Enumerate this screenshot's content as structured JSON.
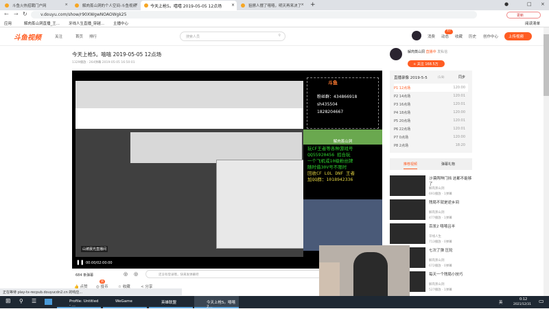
{
  "tabs": [
    {
      "label": "斗鱼火热招聘门户网"
    },
    {
      "label": "解肉蒸山洞的个人空间-斗鱼视频"
    },
    {
      "label": "今天上枪5。嘻嘻 2019-05-05 12点场"
    },
    {
      "label": "狙擦人摆了嘻嘻，明天再来决了"
    }
  ],
  "address": {
    "url": "v.douyu.com/show/r90XWgwNOAOWgk25",
    "update_label": "更新"
  },
  "bookmarks": [
    "应用",
    "解肉蒸山洞直播_王...",
    "牙线人生直播_穿越...",
    "主播中心"
  ],
  "bookmarks_right": "阅读清单",
  "header": {
    "logo": "斗鱼视频",
    "follow": "关注",
    "nav": [
      "首页",
      "排行"
    ],
    "search_placeholder": "搜索人员",
    "links": [
      "消费",
      "动态",
      "收藏",
      "历史",
      "创作中心"
    ],
    "badge": "47",
    "upload": "上传视频"
  },
  "video": {
    "title": "今天上枪5。嘻嘻 2019-05-05 12点场",
    "meta": "1329播放 · 264弹幕  2019-05-05 16:50:01",
    "time": "00:00/02:00:00",
    "inner_label": "山坡晨光直播间",
    "danmaku_count": "684 条弹幕",
    "danmaku_placeholder": "还没有登录哦，快来发弹幕吧"
  },
  "overlay": {
    "qq_group_label": "粉丝群：434866918",
    "wechat": "sh435504",
    "qq": "1828204667",
    "brand": "斗鱼",
    "name": "解肉蒸山洞",
    "lines": [
      "玩CF王者等各种游戏号",
      "QQ55920456 招合玩",
      "一个飞机或10级粉丝牌",
      "随时借30V号不限时",
      "回收CF LOL DNF 王者",
      "加QQ群：1018942336"
    ]
  },
  "actions": [
    {
      "label": "点赞"
    },
    {
      "label": "投币",
      "badge": "热"
    },
    {
      "label": "收藏"
    },
    {
      "label": "分享"
    }
  ],
  "streamer": {
    "name": "解肉蒸山洞",
    "tag": "直播中",
    "other": "发私信",
    "follow": "+ 关注 168.5万"
  },
  "episodes": {
    "title": "直播录像 2019-5-5",
    "count": "(1/8)",
    "sort": "同步",
    "items": [
      {
        "name": "P1 12点场",
        "time": "120:00"
      },
      {
        "name": "P2 14点场",
        "time": "120:01"
      },
      {
        "name": "P3 16点场",
        "time": "120:01"
      },
      {
        "name": "P4 18点场",
        "time": "120:00"
      },
      {
        "name": "P5 20点场",
        "time": "120:01"
      },
      {
        "name": "P6 22点场",
        "time": "120:01"
      },
      {
        "name": "P7 0点场",
        "time": "120:00"
      },
      {
        "name": "P8 2点场",
        "time": "18:20"
      }
    ]
  },
  "rec_tabs": [
    "推荐视频",
    "弹幕礼物"
  ],
  "recommended": [
    {
      "title": "沙漠两种门挡 这都不能够了",
      "author": "解肉蒸山洞",
      "stats": "691播放 · 1弹幕"
    },
    {
      "title": "残局不就是逆乡间",
      "author": "解肉蒸山洞",
      "stats": "477播放 · 1弹幕"
    },
    {
      "title": "百发2 嘻嘻吕半",
      "author": "牙线人生",
      "stats": "713播放 · 0弹幕"
    },
    {
      "title": "七次了弹 压轮",
      "author": "解肉蒸山洞",
      "stats": "672播放 · 0弹幕"
    },
    {
      "title": "每天一个残局小技巧",
      "author": "解肉蒸山洞",
      "stats": "527播放 · 1弹幕"
    }
  ],
  "status_bar": "正在等待 play-tx-recpub.douyucdn2.cn 的响应...",
  "taskbar": {
    "apps": [
      "Profile: Untitled - ...",
      "WeGame",
      "英雄联盟",
      "今天上枪5。嘻嘻 2..."
    ],
    "time": "0:12",
    "date": "2021/12/31",
    "ime": "英"
  },
  "colors": {
    "accent": "#ff5d23"
  }
}
